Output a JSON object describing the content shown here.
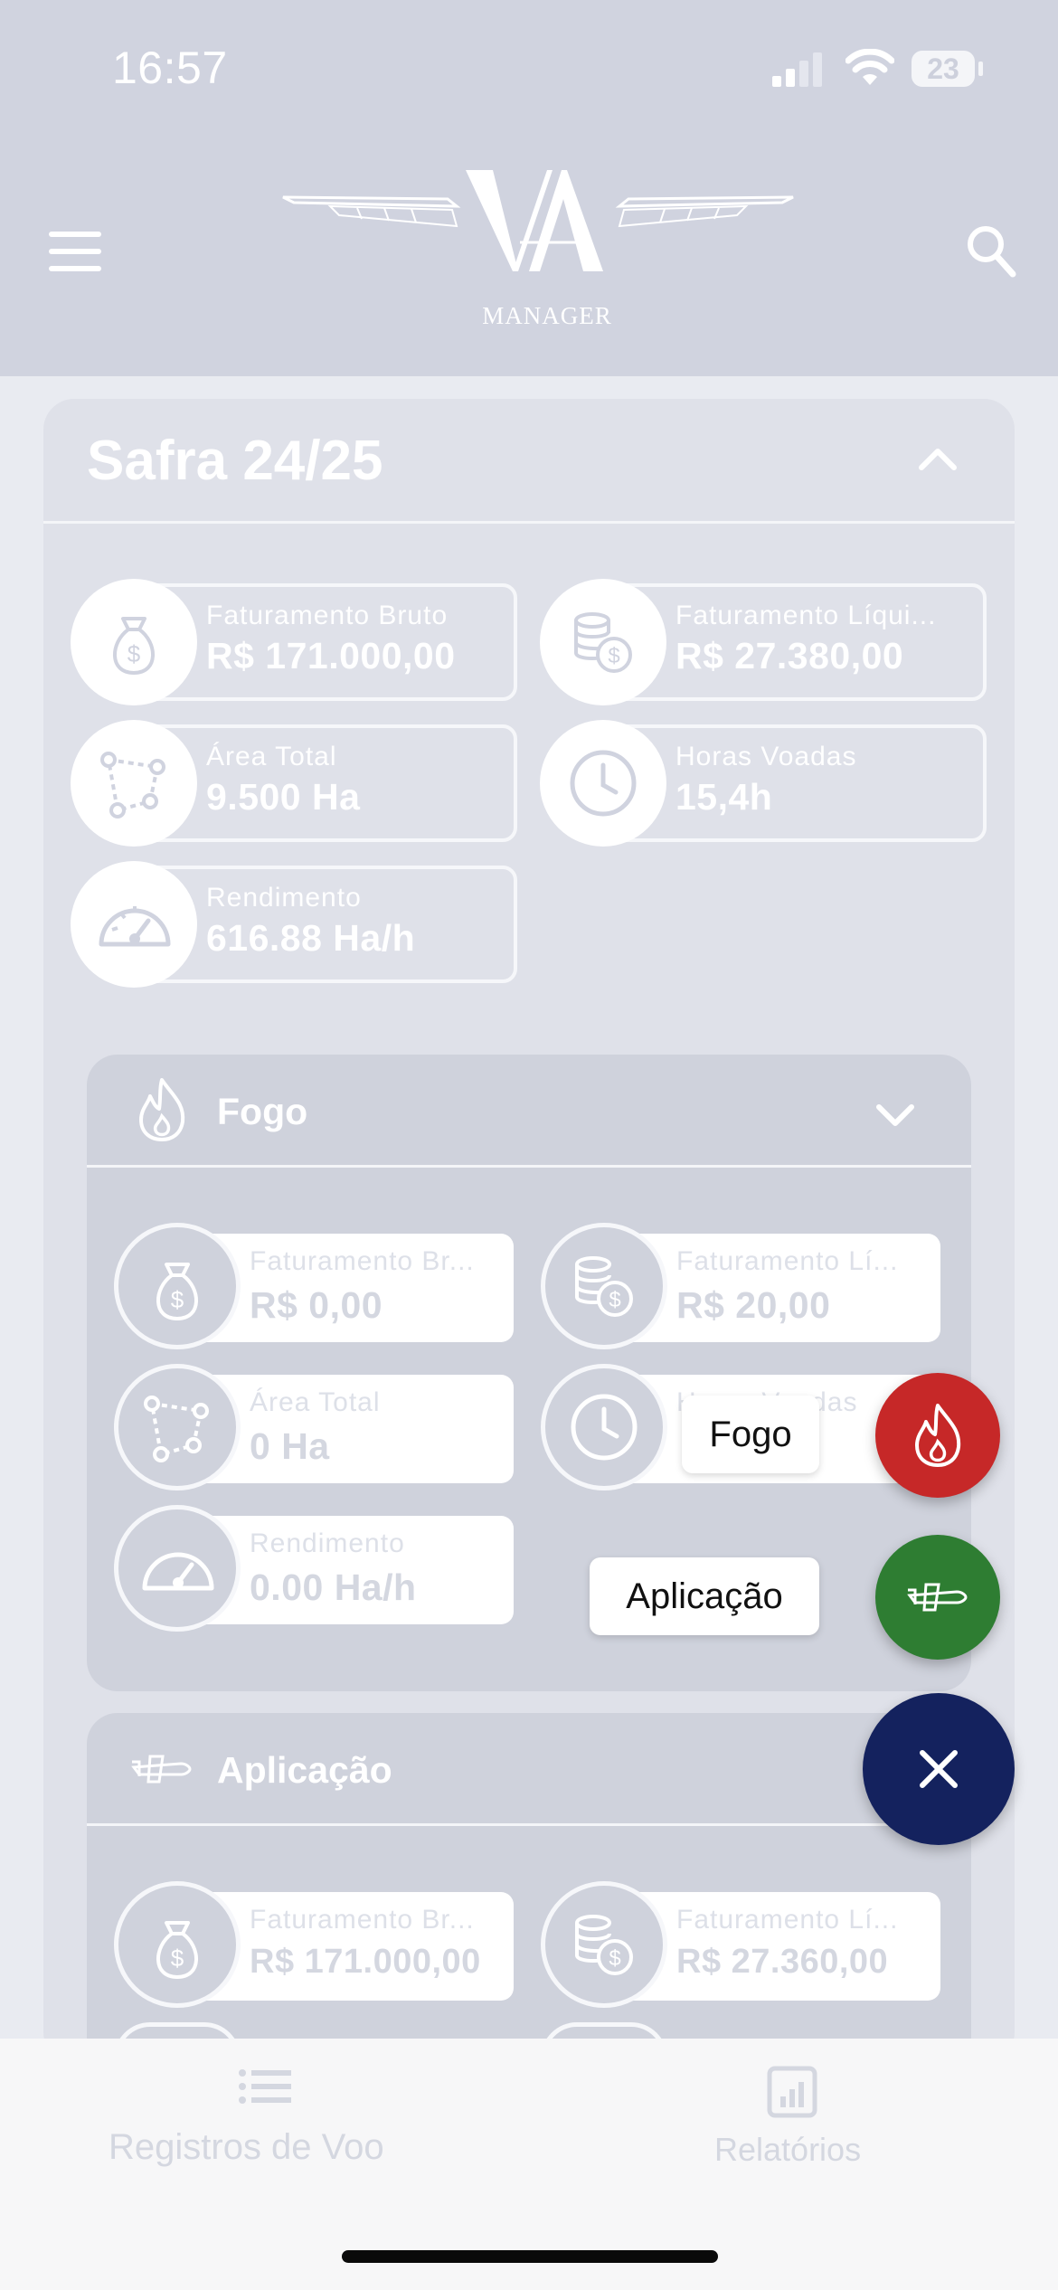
{
  "status_bar": {
    "time": "16:57",
    "battery": "23"
  },
  "header": {
    "logo_text": "MANAGER"
  },
  "safra": {
    "title": "Safra 24/25",
    "stats": [
      {
        "label": "Faturamento Bruto",
        "value": "R$ 171.000,00",
        "icon": "money-bag-icon"
      },
      {
        "label": "Faturamento Líqui...",
        "value": "R$ 27.380,00",
        "icon": "coins-icon"
      },
      {
        "label": "Área Total",
        "value": "9.500 Ha",
        "icon": "area-polygon-icon"
      },
      {
        "label": "Horas Voadas",
        "value": "15,4h",
        "icon": "clock-icon"
      },
      {
        "label": "Rendimento",
        "value": "616.88 Ha/h",
        "icon": "gauge-icon"
      }
    ]
  },
  "fogo": {
    "title": "Fogo",
    "stats": [
      {
        "label": "Faturamento Br...",
        "value": "R$ 0,00"
      },
      {
        "label": "Faturamento Lí...",
        "value": "R$ 20,00"
      },
      {
        "label": "Área Total",
        "value": "0 Ha"
      },
      {
        "label": "Horas Voadas",
        "value": ""
      },
      {
        "label": "Rendimento",
        "value": "0.00 Ha/h"
      }
    ]
  },
  "aplicacao": {
    "title": "Aplicação",
    "stats": [
      {
        "label": "Faturamento Br...",
        "value": "R$ 171.000,00"
      },
      {
        "label": "Faturamento Lí...",
        "value": "R$ 27.360,00"
      }
    ]
  },
  "fab": {
    "fogo_label": "Fogo",
    "aplicacao_label": "Aplicação"
  },
  "bottom_nav": {
    "tab1": "Registros de Voo",
    "tab2": "Relatórios"
  },
  "colors": {
    "fab_fire": "#c62828",
    "fab_plane": "#2e7d32",
    "fab_close": "#14225e"
  }
}
